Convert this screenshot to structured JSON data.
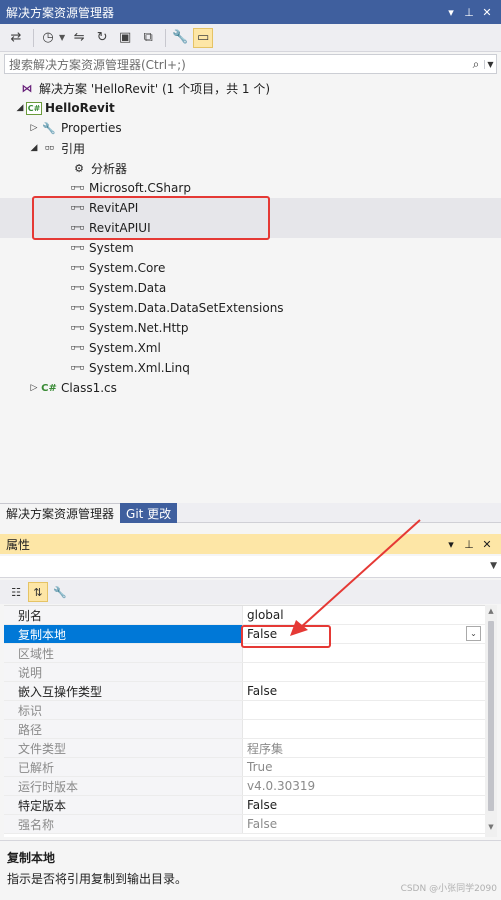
{
  "solution_explorer": {
    "title": "解决方案资源管理器",
    "search_placeholder": "搜索解决方案资源管理器(Ctrl+;)",
    "tree": [
      {
        "label": "解决方案 'HelloRevit' (1 个项目，共 1 个)",
        "icon": "solution-icon",
        "depth": 0
      },
      {
        "label": "HelloRevit",
        "icon": "csharp-project-icon",
        "depth": 1,
        "bold": true,
        "expanded": true
      },
      {
        "label": "Properties",
        "icon": "wrench-icon",
        "depth": 2,
        "expanded": false
      },
      {
        "label": "引用",
        "icon": "references-icon",
        "depth": 2,
        "expanded": true
      },
      {
        "label": "分析器",
        "icon": "analyzer-icon",
        "depth": 3
      },
      {
        "label": "Microsoft.CSharp",
        "icon": "reference-icon",
        "depth": 3
      },
      {
        "label": "RevitAPI",
        "icon": "reference-icon",
        "depth": 3
      },
      {
        "label": "RevitAPIUI",
        "icon": "reference-icon",
        "depth": 3
      },
      {
        "label": "System",
        "icon": "reference-icon",
        "depth": 3
      },
      {
        "label": "System.Core",
        "icon": "reference-icon",
        "depth": 3
      },
      {
        "label": "System.Data",
        "icon": "reference-icon",
        "depth": 3
      },
      {
        "label": "System.Data.DataSetExtensions",
        "icon": "reference-icon",
        "depth": 3
      },
      {
        "label": "System.Net.Http",
        "icon": "reference-icon",
        "depth": 3
      },
      {
        "label": "System.Xml",
        "icon": "reference-icon",
        "depth": 3
      },
      {
        "label": "System.Xml.Linq",
        "icon": "reference-icon",
        "depth": 3
      },
      {
        "label": "Class1.cs",
        "icon": "csharp-file-icon",
        "depth": 2,
        "expanded": false
      }
    ],
    "tabs": [
      "解决方案资源管理器",
      "Git 更改"
    ]
  },
  "properties": {
    "title": "属性",
    "rows": [
      {
        "name": "别名",
        "value": "global",
        "disabled": false
      },
      {
        "name": "复制本地",
        "value": "False",
        "disabled": false,
        "selected": true
      },
      {
        "name": "区域性",
        "value": "",
        "disabled": true
      },
      {
        "name": "说明",
        "value": "",
        "disabled": true
      },
      {
        "name": "嵌入互操作类型",
        "value": "False",
        "disabled": false
      },
      {
        "name": "标识",
        "value": "",
        "disabled": true
      },
      {
        "name": "路径",
        "value": "",
        "disabled": true
      },
      {
        "name": "文件类型",
        "value": "程序集",
        "disabled": true
      },
      {
        "name": "已解析",
        "value": "True",
        "disabled": true
      },
      {
        "name": "运行时版本",
        "value": "v4.0.30319",
        "disabled": true
      },
      {
        "name": "特定版本",
        "value": "False",
        "disabled": false
      },
      {
        "name": "强名称",
        "value": "False",
        "disabled": true
      }
    ],
    "description_title": "复制本地",
    "description_text": "指示是否将引用复制到输出目录。"
  },
  "watermark": "CSDN @小张同学2090",
  "colors": {
    "title_bar": "#3f5f9e",
    "highlight_box": "#e53935",
    "selected_row": "#0078d7",
    "properties_title": "#fde6a6"
  }
}
